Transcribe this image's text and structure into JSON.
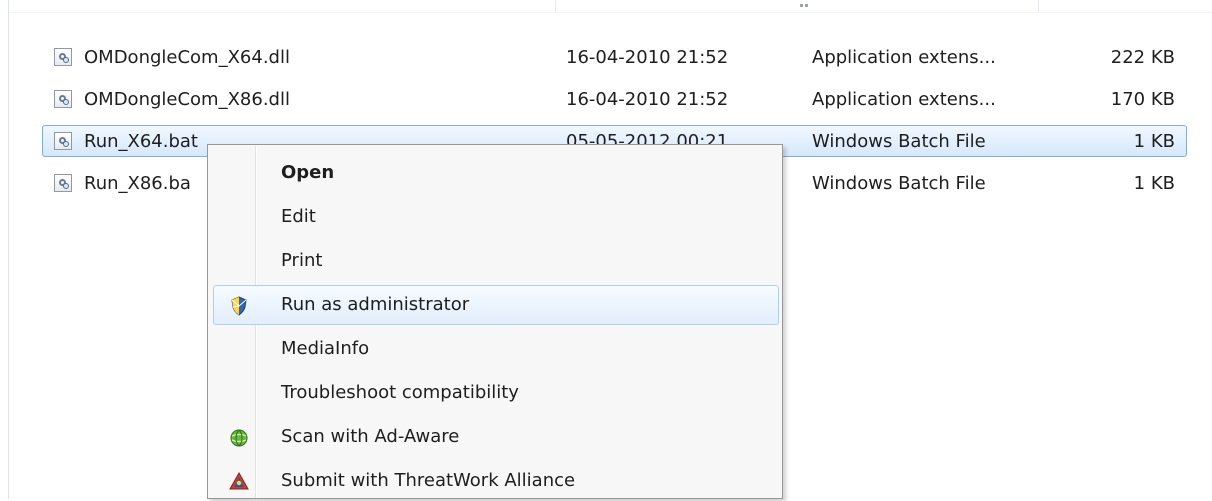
{
  "files": [
    {
      "name": "OMDongleCom_X64.dll",
      "date": "16-04-2010 21:52",
      "type": "Application extens...",
      "size": "222 KB",
      "selected": false
    },
    {
      "name": "OMDongleCom_X86.dll",
      "date": "16-04-2010 21:52",
      "type": "Application extens...",
      "size": "170 KB",
      "selected": false
    },
    {
      "name": "Run_X64.bat",
      "date": "05-05-2012 00:21",
      "type": "Windows Batch File",
      "size": "1 KB",
      "selected": true
    },
    {
      "name": "Run_X86.ba",
      "date": "",
      "type": "Windows Batch File",
      "size": "1 KB",
      "selected": false
    }
  ],
  "context_menu": {
    "items": [
      {
        "label": "Open",
        "bold": true,
        "icon": ""
      },
      {
        "label": "Edit",
        "bold": false,
        "icon": ""
      },
      {
        "label": "Print",
        "bold": false,
        "icon": ""
      },
      {
        "label": "Run as administrator",
        "bold": false,
        "icon": "uac-shield-icon",
        "hover": true
      },
      {
        "label": "MediaInfo",
        "bold": false,
        "icon": ""
      },
      {
        "label": "Troubleshoot compatibility",
        "bold": false,
        "icon": ""
      },
      {
        "label": "Scan with Ad-Aware",
        "bold": false,
        "icon": "ad-aware-icon"
      },
      {
        "label": "Submit with ThreatWork Alliance",
        "bold": false,
        "icon": "threatwork-alliance-icon"
      }
    ]
  },
  "colors": {
    "selection_border": "#84acdd",
    "menu_hover_border": "#aecff7",
    "menu_background": "#f7f7f7"
  }
}
